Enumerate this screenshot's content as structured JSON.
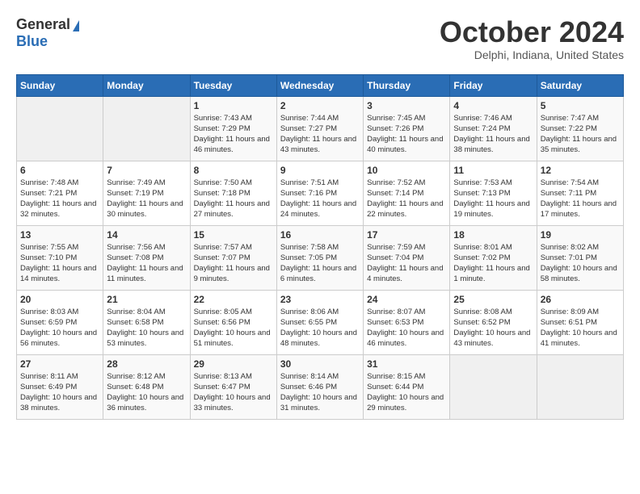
{
  "header": {
    "logo_general": "General",
    "logo_blue": "Blue",
    "month_title": "October 2024",
    "location": "Delphi, Indiana, United States"
  },
  "days_of_week": [
    "Sunday",
    "Monday",
    "Tuesday",
    "Wednesday",
    "Thursday",
    "Friday",
    "Saturday"
  ],
  "weeks": [
    [
      {
        "day": "",
        "info": ""
      },
      {
        "day": "",
        "info": ""
      },
      {
        "day": "1",
        "info": "Sunrise: 7:43 AM\nSunset: 7:29 PM\nDaylight: 11 hours and 46 minutes."
      },
      {
        "day": "2",
        "info": "Sunrise: 7:44 AM\nSunset: 7:27 PM\nDaylight: 11 hours and 43 minutes."
      },
      {
        "day": "3",
        "info": "Sunrise: 7:45 AM\nSunset: 7:26 PM\nDaylight: 11 hours and 40 minutes."
      },
      {
        "day": "4",
        "info": "Sunrise: 7:46 AM\nSunset: 7:24 PM\nDaylight: 11 hours and 38 minutes."
      },
      {
        "day": "5",
        "info": "Sunrise: 7:47 AM\nSunset: 7:22 PM\nDaylight: 11 hours and 35 minutes."
      }
    ],
    [
      {
        "day": "6",
        "info": "Sunrise: 7:48 AM\nSunset: 7:21 PM\nDaylight: 11 hours and 32 minutes."
      },
      {
        "day": "7",
        "info": "Sunrise: 7:49 AM\nSunset: 7:19 PM\nDaylight: 11 hours and 30 minutes."
      },
      {
        "day": "8",
        "info": "Sunrise: 7:50 AM\nSunset: 7:18 PM\nDaylight: 11 hours and 27 minutes."
      },
      {
        "day": "9",
        "info": "Sunrise: 7:51 AM\nSunset: 7:16 PM\nDaylight: 11 hours and 24 minutes."
      },
      {
        "day": "10",
        "info": "Sunrise: 7:52 AM\nSunset: 7:14 PM\nDaylight: 11 hours and 22 minutes."
      },
      {
        "day": "11",
        "info": "Sunrise: 7:53 AM\nSunset: 7:13 PM\nDaylight: 11 hours and 19 minutes."
      },
      {
        "day": "12",
        "info": "Sunrise: 7:54 AM\nSunset: 7:11 PM\nDaylight: 11 hours and 17 minutes."
      }
    ],
    [
      {
        "day": "13",
        "info": "Sunrise: 7:55 AM\nSunset: 7:10 PM\nDaylight: 11 hours and 14 minutes."
      },
      {
        "day": "14",
        "info": "Sunrise: 7:56 AM\nSunset: 7:08 PM\nDaylight: 11 hours and 11 minutes."
      },
      {
        "day": "15",
        "info": "Sunrise: 7:57 AM\nSunset: 7:07 PM\nDaylight: 11 hours and 9 minutes."
      },
      {
        "day": "16",
        "info": "Sunrise: 7:58 AM\nSunset: 7:05 PM\nDaylight: 11 hours and 6 minutes."
      },
      {
        "day": "17",
        "info": "Sunrise: 7:59 AM\nSunset: 7:04 PM\nDaylight: 11 hours and 4 minutes."
      },
      {
        "day": "18",
        "info": "Sunrise: 8:01 AM\nSunset: 7:02 PM\nDaylight: 11 hours and 1 minute."
      },
      {
        "day": "19",
        "info": "Sunrise: 8:02 AM\nSunset: 7:01 PM\nDaylight: 10 hours and 58 minutes."
      }
    ],
    [
      {
        "day": "20",
        "info": "Sunrise: 8:03 AM\nSunset: 6:59 PM\nDaylight: 10 hours and 56 minutes."
      },
      {
        "day": "21",
        "info": "Sunrise: 8:04 AM\nSunset: 6:58 PM\nDaylight: 10 hours and 53 minutes."
      },
      {
        "day": "22",
        "info": "Sunrise: 8:05 AM\nSunset: 6:56 PM\nDaylight: 10 hours and 51 minutes."
      },
      {
        "day": "23",
        "info": "Sunrise: 8:06 AM\nSunset: 6:55 PM\nDaylight: 10 hours and 48 minutes."
      },
      {
        "day": "24",
        "info": "Sunrise: 8:07 AM\nSunset: 6:53 PM\nDaylight: 10 hours and 46 minutes."
      },
      {
        "day": "25",
        "info": "Sunrise: 8:08 AM\nSunset: 6:52 PM\nDaylight: 10 hours and 43 minutes."
      },
      {
        "day": "26",
        "info": "Sunrise: 8:09 AM\nSunset: 6:51 PM\nDaylight: 10 hours and 41 minutes."
      }
    ],
    [
      {
        "day": "27",
        "info": "Sunrise: 8:11 AM\nSunset: 6:49 PM\nDaylight: 10 hours and 38 minutes."
      },
      {
        "day": "28",
        "info": "Sunrise: 8:12 AM\nSunset: 6:48 PM\nDaylight: 10 hours and 36 minutes."
      },
      {
        "day": "29",
        "info": "Sunrise: 8:13 AM\nSunset: 6:47 PM\nDaylight: 10 hours and 33 minutes."
      },
      {
        "day": "30",
        "info": "Sunrise: 8:14 AM\nSunset: 6:46 PM\nDaylight: 10 hours and 31 minutes."
      },
      {
        "day": "31",
        "info": "Sunrise: 8:15 AM\nSunset: 6:44 PM\nDaylight: 10 hours and 29 minutes."
      },
      {
        "day": "",
        "info": ""
      },
      {
        "day": "",
        "info": ""
      }
    ]
  ]
}
